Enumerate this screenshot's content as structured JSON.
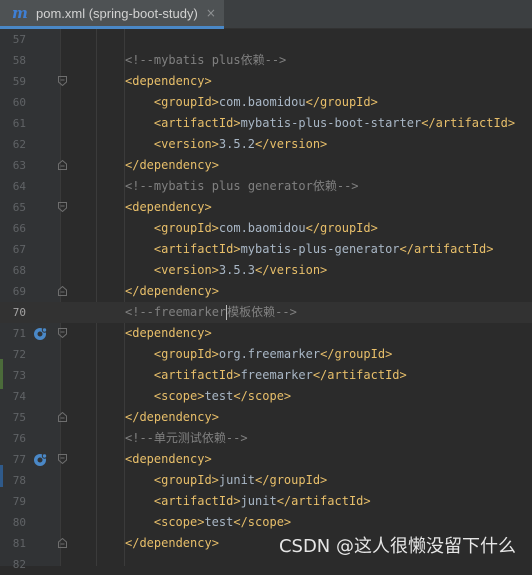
{
  "tab": {
    "icon": "m",
    "title": "pom.xml (spring-boot-study)",
    "close": "×"
  },
  "lines": [
    {
      "num": "57",
      "indent": 0,
      "segments": []
    },
    {
      "num": "58",
      "indent": 1,
      "segments": [
        {
          "c": "t-com",
          "t": "<!--mybatis plus依赖-->"
        }
      ]
    },
    {
      "num": "59",
      "indent": 1,
      "fold": "open",
      "segments": [
        {
          "c": "t-tag",
          "t": "<dependency>"
        }
      ]
    },
    {
      "num": "60",
      "indent": 2,
      "segments": [
        {
          "c": "t-tag",
          "t": "<groupId>"
        },
        {
          "c": "t-txt",
          "t": "com.baomidou"
        },
        {
          "c": "t-tag",
          "t": "</groupId>"
        }
      ]
    },
    {
      "num": "61",
      "indent": 2,
      "segments": [
        {
          "c": "t-tag",
          "t": "<artifactId>"
        },
        {
          "c": "t-txt",
          "t": "mybatis-plus-boot-starter"
        },
        {
          "c": "t-tag",
          "t": "</artifactId>"
        }
      ]
    },
    {
      "num": "62",
      "indent": 2,
      "segments": [
        {
          "c": "t-tag",
          "t": "<version>"
        },
        {
          "c": "t-txt",
          "t": "3.5.2"
        },
        {
          "c": "t-tag",
          "t": "</version>"
        }
      ]
    },
    {
      "num": "63",
      "indent": 1,
      "fold": "close",
      "segments": [
        {
          "c": "t-tag",
          "t": "</dependency>"
        }
      ]
    },
    {
      "num": "64",
      "indent": 1,
      "segments": [
        {
          "c": "t-com",
          "t": "<!--mybatis plus generator依赖-->"
        }
      ]
    },
    {
      "num": "65",
      "indent": 1,
      "fold": "open",
      "segments": [
        {
          "c": "t-tag",
          "t": "<dependency>"
        }
      ]
    },
    {
      "num": "66",
      "indent": 2,
      "segments": [
        {
          "c": "t-tag",
          "t": "<groupId>"
        },
        {
          "c": "t-txt",
          "t": "com.baomidou"
        },
        {
          "c": "t-tag",
          "t": "</groupId>"
        }
      ]
    },
    {
      "num": "67",
      "indent": 2,
      "segments": [
        {
          "c": "t-tag",
          "t": "<artifactId>"
        },
        {
          "c": "t-txt",
          "t": "mybatis-plus-generator"
        },
        {
          "c": "t-tag",
          "t": "</artifactId>"
        }
      ]
    },
    {
      "num": "68",
      "indent": 2,
      "segments": [
        {
          "c": "t-tag",
          "t": "<version>"
        },
        {
          "c": "t-txt",
          "t": "3.5.3"
        },
        {
          "c": "t-tag",
          "t": "</version>"
        }
      ]
    },
    {
      "num": "69",
      "indent": 1,
      "fold": "close",
      "segments": [
        {
          "c": "t-tag",
          "t": "</dependency>"
        }
      ]
    },
    {
      "num": "70",
      "indent": 1,
      "current": true,
      "segments": [
        {
          "c": "t-com",
          "t": "<!--freemarker"
        },
        {
          "caret": true
        },
        {
          "c": "t-com",
          "t": "模板依赖-->"
        }
      ]
    },
    {
      "num": "71",
      "indent": 1,
      "fold": "open",
      "run": true,
      "segments": [
        {
          "c": "t-tag",
          "t": "<dependency>"
        }
      ]
    },
    {
      "num": "72",
      "indent": 2,
      "segments": [
        {
          "c": "t-tag",
          "t": "<groupId>"
        },
        {
          "c": "t-txt",
          "t": "org.freemarker"
        },
        {
          "c": "t-tag",
          "t": "</groupId>"
        }
      ]
    },
    {
      "num": "73",
      "indent": 2,
      "segments": [
        {
          "c": "t-tag",
          "t": "<artifactId>"
        },
        {
          "c": "t-txt",
          "t": "freemarker"
        },
        {
          "c": "t-tag",
          "t": "</artifactId>"
        }
      ]
    },
    {
      "num": "74",
      "indent": 2,
      "segments": [
        {
          "c": "t-tag",
          "t": "<scope>"
        },
        {
          "c": "t-txt",
          "t": "test"
        },
        {
          "c": "t-tag",
          "t": "</scope>"
        }
      ]
    },
    {
      "num": "75",
      "indent": 1,
      "fold": "close",
      "segments": [
        {
          "c": "t-tag",
          "t": "</dependency>"
        }
      ]
    },
    {
      "num": "76",
      "indent": 1,
      "segments": [
        {
          "c": "t-com",
          "t": "<!--单元测试依赖-->"
        }
      ]
    },
    {
      "num": "77",
      "indent": 1,
      "fold": "open",
      "run": true,
      "segments": [
        {
          "c": "t-tag",
          "t": "<dependency>"
        }
      ]
    },
    {
      "num": "78",
      "indent": 2,
      "segments": [
        {
          "c": "t-tag",
          "t": "<groupId>"
        },
        {
          "c": "t-txt",
          "t": "junit"
        },
        {
          "c": "t-tag",
          "t": "</groupId>"
        }
      ]
    },
    {
      "num": "79",
      "indent": 2,
      "segments": [
        {
          "c": "t-tag",
          "t": "<artifactId>"
        },
        {
          "c": "t-txt",
          "t": "junit"
        },
        {
          "c": "t-tag",
          "t": "</artifactId>"
        }
      ]
    },
    {
      "num": "80",
      "indent": 2,
      "segments": [
        {
          "c": "t-tag",
          "t": "<scope>"
        },
        {
          "c": "t-txt",
          "t": "test"
        },
        {
          "c": "t-tag",
          "t": "</scope>"
        }
      ]
    },
    {
      "num": "81",
      "indent": 1,
      "fold": "close",
      "segments": [
        {
          "c": "t-tag",
          "t": "</dependency>"
        }
      ]
    },
    {
      "num": "82",
      "indent": 0,
      "segments": []
    }
  ],
  "watermark": "CSDN @这人很懒没留下什么",
  "colors": {
    "background": "#2b2b2b",
    "gutter": "#313335",
    "tag": "#e8bf6a",
    "comment": "#808080",
    "text": "#a9b7c6",
    "run_icon": "#4a88c7"
  }
}
